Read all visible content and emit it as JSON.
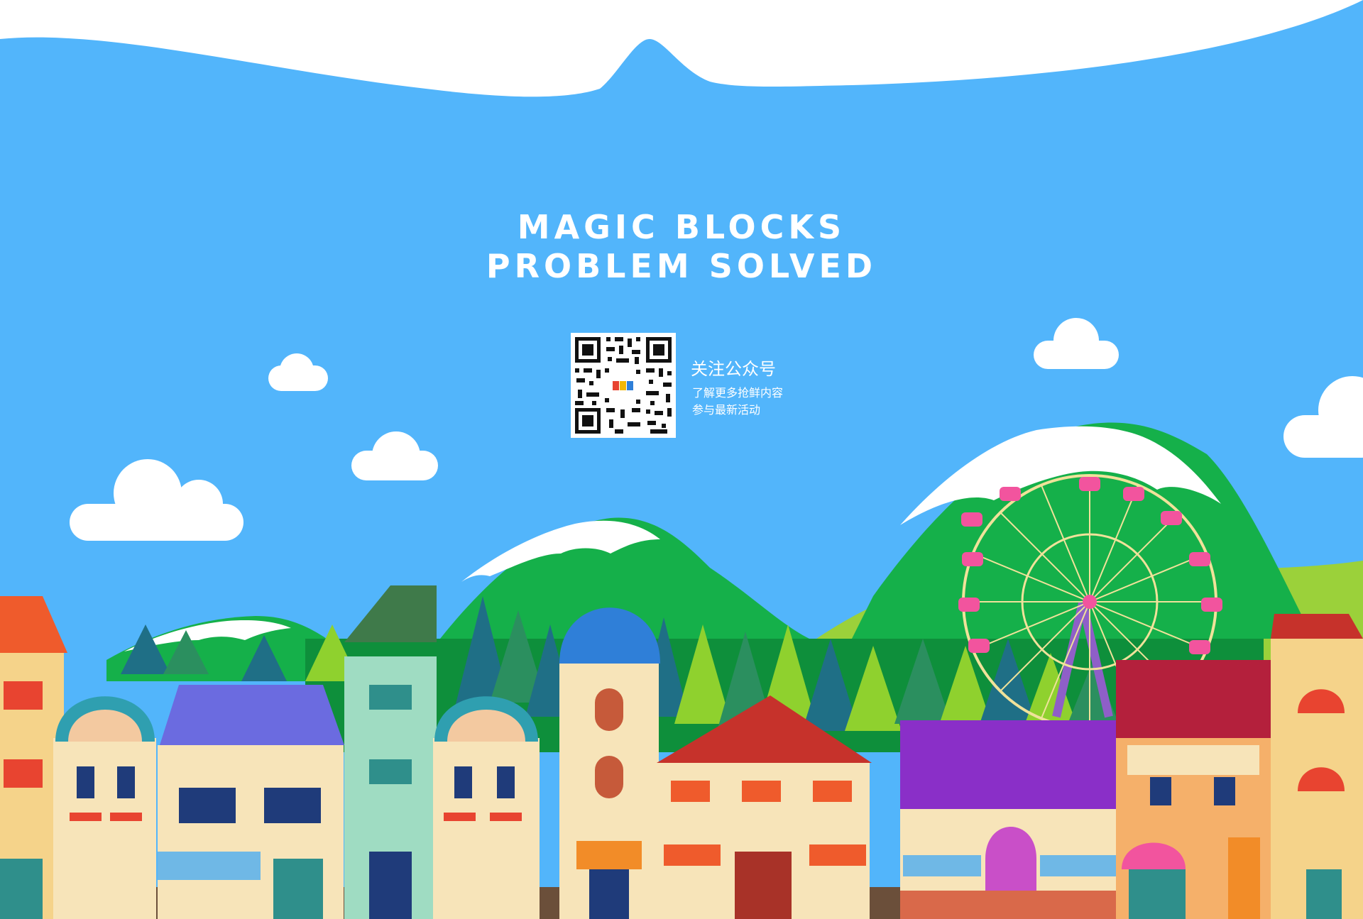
{
  "hero": {
    "title_line1": "MAGIC BLOCKS",
    "title_line2": "PROBLEM SOLVED"
  },
  "qr": {
    "title": "关注公众号",
    "line1": "了解更多抢鲜内容",
    "line2": "参与最新活动"
  },
  "colors": {
    "sky": "#52b5fb",
    "snow": "#ffffff",
    "mountain": "#15b04a",
    "mountain_dark": "#0e8f3b",
    "hill": "#9bd13a",
    "pine_dark": "#1f6f86",
    "pine_light": "#8fd12e",
    "wheel": "#f0e29a",
    "gondola": "#f2549e",
    "ground": "#6b4f3a"
  },
  "icons": {
    "qr": "qr-code-icon",
    "logo": "magic-blocks-logo"
  }
}
